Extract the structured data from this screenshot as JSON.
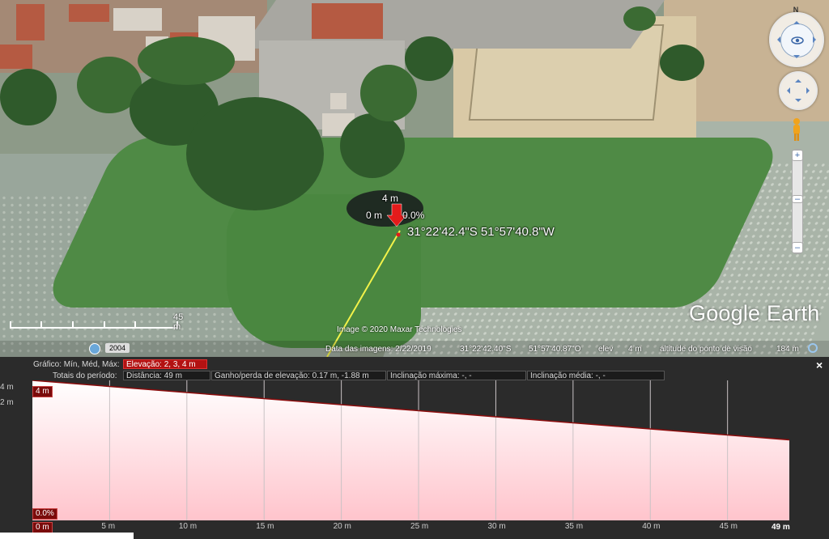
{
  "map": {
    "path_labels": {
      "elevation_top": "4 m",
      "start": "0 m",
      "grade": "0.0%"
    },
    "coordinates": "31°22'42.4\"S 51°57'40.8\"W",
    "scale": "45 m",
    "brand": "Google Earth",
    "copyright": "Image © 2020 Maxar Technologies",
    "history_year": "2004",
    "north": "N"
  },
  "status_bar": {
    "imagery_date": "Data das imagens: 2/22/2019",
    "lat": "31°22'42.40\"S",
    "lon": "51°57'40.87\"O",
    "elev_label": "elev",
    "elev_value": "4 m",
    "eye_label": "altitude do ponto de visão",
    "eye_value": "184 m"
  },
  "panel": {
    "close": "×",
    "graph_label": "Gráfico: Mín, Méd, Máx:",
    "elevation": "Elevação: 2, 3, 4 m",
    "totals_label": "Totais do período:",
    "distance": "Distância: 49 m",
    "gain_loss": "Ganho/perda de elevação: 0.17 m, -1.88 m",
    "max_slope": "Inclinação máxima: -, -",
    "avg_slope": "Inclinação média: -, -",
    "y_ticks": [
      "4 m",
      "2 m"
    ],
    "badge_top": "4 m",
    "badge_bottom": "0.0%",
    "badge_origin": "0 m",
    "badge_end": "49 m"
  },
  "chart_data": {
    "type": "area",
    "x": [
      0,
      49
    ],
    "y": [
      4,
      2.3
    ],
    "x_ticks": [
      "5 m",
      "10 m",
      "15 m",
      "20 m",
      "25 m",
      "30 m",
      "35 m",
      "40 m",
      "45 m"
    ],
    "x_tick_values": [
      5,
      10,
      15,
      20,
      25,
      30,
      35,
      40,
      45
    ],
    "xlim": [
      0,
      49
    ],
    "ylim": [
      0,
      4
    ],
    "grid": true,
    "line_color": "#8b0c0c",
    "fill_color": "#ffd0d6"
  }
}
